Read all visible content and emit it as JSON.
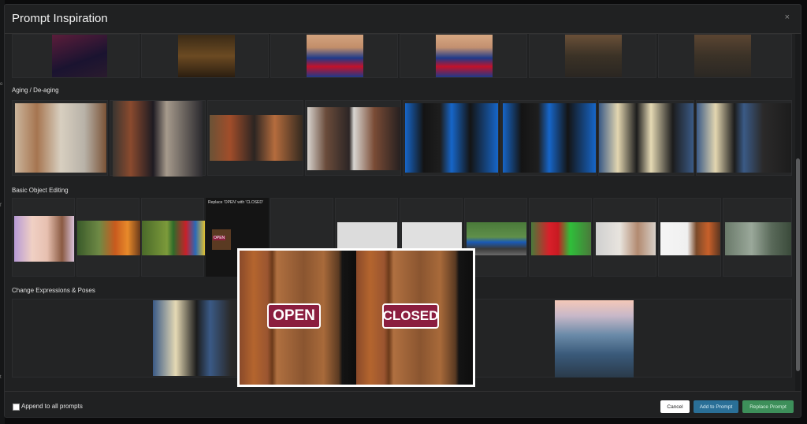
{
  "modal": {
    "title": "Prompt Inspiration",
    "close_glyph": "×"
  },
  "sections": [
    {
      "id": "aging",
      "label": "Aging / De-aging"
    },
    {
      "id": "object",
      "label": "Basic Object Editing"
    },
    {
      "id": "expr",
      "label": "Change Expressions & Poses"
    }
  ],
  "tooltip": {
    "text": "Replace 'OPEN' with 'CLOSED'",
    "mini_text": "OPEN"
  },
  "preview": {
    "left_sign": "OPEN",
    "right_sign": "CLOSED"
  },
  "footer": {
    "append_label": "Append to all prompts",
    "append_checked": false,
    "cancel_label": "Cancel",
    "add_label": "Add to Prompt",
    "replace_label": "Replace Prompt"
  },
  "left_edge_glyphs": [
    "o",
    "f",
    "t"
  ],
  "colors": {
    "add_button": "#2a6f97",
    "replace_button": "#3d8f5a",
    "sign_red": "#8b1e3f",
    "annotation_red": "#d8262b"
  }
}
